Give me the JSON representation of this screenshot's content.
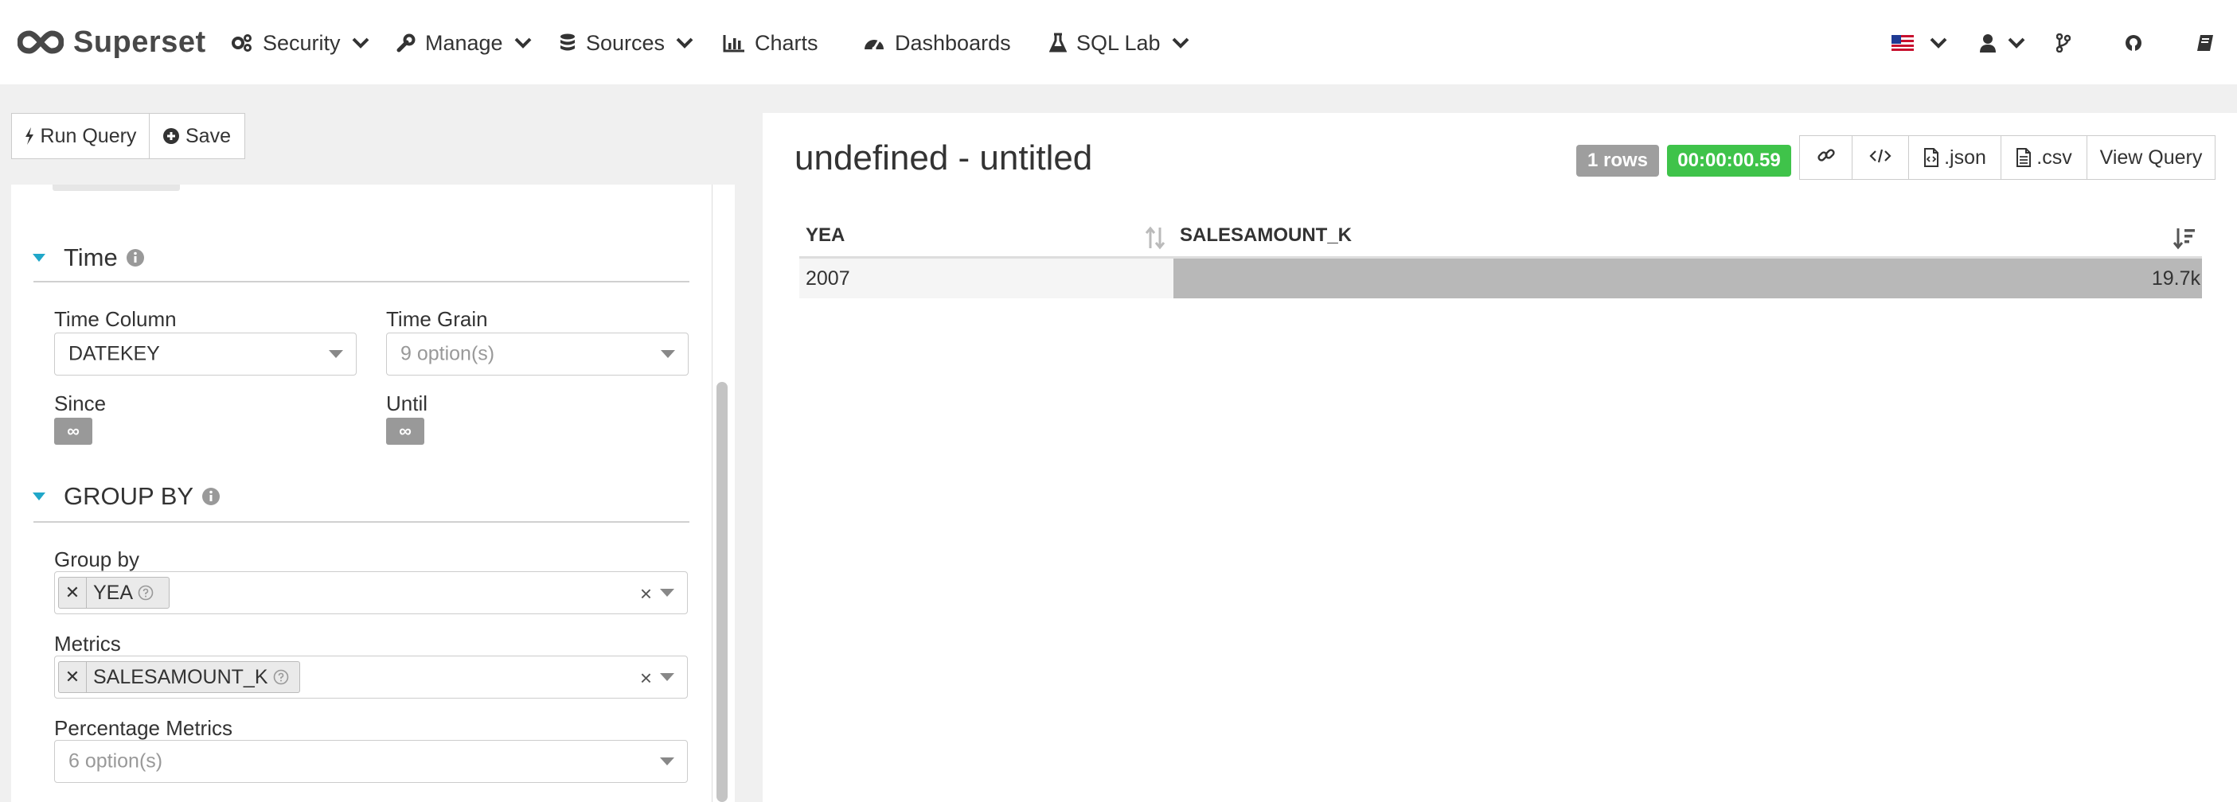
{
  "navbar": {
    "brand": "Superset",
    "items": [
      {
        "label": "Security"
      },
      {
        "label": "Manage"
      },
      {
        "label": "Sources"
      },
      {
        "label": "Charts"
      },
      {
        "label": "Dashboards"
      },
      {
        "label": "SQL Lab"
      }
    ]
  },
  "toolbar": {
    "run_query": "Run Query",
    "save": "Save"
  },
  "time_section": {
    "title": "Time",
    "time_column_label": "Time Column",
    "time_column_value": "DATEKEY",
    "time_grain_label": "Time Grain",
    "time_grain_placeholder": "9 option(s)",
    "since_label": "Since",
    "until_label": "Until",
    "infinity_symbol": "∞"
  },
  "groupby_section": {
    "title": "GROUP BY",
    "group_by_label": "Group by",
    "group_by_tag": "YEA",
    "metrics_label": "Metrics",
    "metrics_tag": "SALESAMOUNT_K",
    "percentage_label": "Percentage Metrics",
    "percentage_placeholder": "6 option(s)",
    "clear_symbol": "×"
  },
  "result": {
    "title": "undefined - untitled",
    "rows_badge": "1 rows",
    "time_badge": "00:00:00.59",
    "json_label": ".json",
    "csv_label": ".csv",
    "view_query_label": "View Query",
    "columns": [
      "YEA",
      "SALESAMOUNT_K"
    ],
    "rows": [
      {
        "yea": "2007",
        "salesamount_k": "19.7k",
        "bar_fraction": 1.0
      }
    ]
  },
  "colors": {
    "accent_teal": "#20a7c9",
    "rows_badge": "#9e9e9e",
    "time_badge": "#3fc34a",
    "bar_fill": "#b8b8b8"
  }
}
